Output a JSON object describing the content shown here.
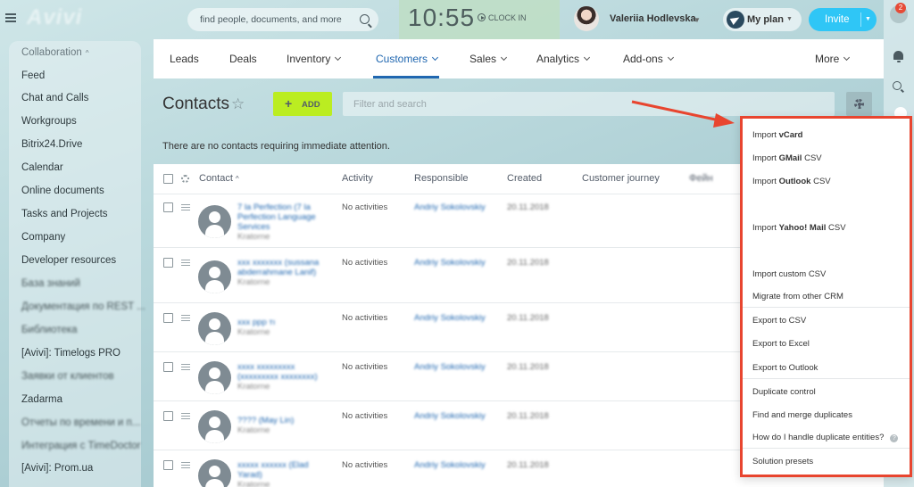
{
  "topbar": {
    "logo": "Avivi",
    "search_placeholder": "find people, documents, and more",
    "clock_time": "10:55",
    "clock_in_label": "CLOCK IN",
    "user_name": "Valeriia Hodlevska",
    "myplan_label": "My plan",
    "invite_label": "Invite",
    "notification_count": "2"
  },
  "sidebar": {
    "header": "Collaboration",
    "items": [
      "Feed",
      "Chat and Calls",
      "Workgroups",
      "Bitrix24.Drive",
      "Calendar",
      "Online documents",
      "Tasks and Projects",
      "Company",
      "Developer resources",
      "База знаний",
      "Документация по REST ...",
      "Библиотека",
      "[Avivi]: Timelogs PRO",
      "Заявки от клиентов",
      "Zadarma",
      "Отчеты по времени и п...",
      "Интеграция с TimeDoctor",
      "[Avivi]: Prom.ua"
    ]
  },
  "nav": {
    "items": [
      "Leads",
      "Deals",
      "Inventory",
      "Customers",
      "Sales",
      "Analytics",
      "Add-ons",
      "More"
    ],
    "active": "Customers"
  },
  "page": {
    "title": "Contacts",
    "add_label": "ADD",
    "filter_placeholder": "Filter and search",
    "notice": "There are no contacts requiring immediate attention."
  },
  "table": {
    "columns": [
      "Contact",
      "Activity",
      "Responsible",
      "Created",
      "Customer journey",
      "Фейн"
    ],
    "rows": [
      {
        "name": "7 la Perfection (7 la Perfection Language Services",
        "company": "Kratorne",
        "activity": "No activities",
        "responsible": "Andriy Sokolovskiy",
        "created": "20.11.2018"
      },
      {
        "name": "ххх ххххххх (sussana abderrahmane Lanif)",
        "company": "Kratorne",
        "activity": "No activities",
        "responsible": "Andriy Sokolovskiy",
        "created": "20.11.2018"
      },
      {
        "name": "ххх ррр тı",
        "company": "Kratorne",
        "activity": "No activities",
        "responsible": "Andriy Sokolovskiy",
        "created": "20.11.2018"
      },
      {
        "name": "хххх ххххххххх (ххххххххх хххххххх)",
        "company": "Kratorne",
        "activity": "No activities",
        "responsible": "Andriy Sokolovskiy",
        "created": "20.11.2018"
      },
      {
        "name": "???? (May Lin)",
        "company": "Kratorne",
        "activity": "No activities",
        "responsible": "Andriy Sokolovskiy",
        "created": "20.11.2018"
      },
      {
        "name": "ххххх хххххх (Elad Yarad)",
        "company": "Kratorne",
        "activity": "No activities",
        "responsible": "Andriy Sokolovskiy",
        "created": "20.11.2018"
      }
    ]
  },
  "dropdown": {
    "items": [
      {
        "prefix": "Import ",
        "bold": "vCard",
        "suffix": ""
      },
      {
        "prefix": "Import ",
        "bold": "GMail",
        "suffix": " CSV"
      },
      {
        "prefix": "Import ",
        "bold": "Outlook",
        "suffix": " CSV"
      },
      {
        "prefix": "Import ",
        "bold": "Yahoo! Mail",
        "suffix": " CSV"
      },
      {
        "prefix": "Import custom CSV",
        "bold": "",
        "suffix": ""
      },
      {
        "prefix": "Migrate from other CRM",
        "bold": "",
        "suffix": ""
      },
      {
        "prefix": "Export to CSV",
        "bold": "",
        "suffix": ""
      },
      {
        "prefix": "Export to Excel",
        "bold": "",
        "suffix": ""
      },
      {
        "prefix": "Export to Outlook",
        "bold": "",
        "suffix": ""
      },
      {
        "prefix": "Duplicate control",
        "bold": "",
        "suffix": ""
      },
      {
        "prefix": "Find and merge duplicates",
        "bold": "",
        "suffix": ""
      },
      {
        "prefix": "How do I handle duplicate entities?",
        "bold": "",
        "suffix": ""
      },
      {
        "prefix": "Solution presets",
        "bold": "",
        "suffix": ""
      }
    ]
  },
  "colors": {
    "accent": "#2067b0",
    "add_button": "#bbed21",
    "invite_button": "#2fc6f6",
    "highlight_border": "#e8452f"
  }
}
